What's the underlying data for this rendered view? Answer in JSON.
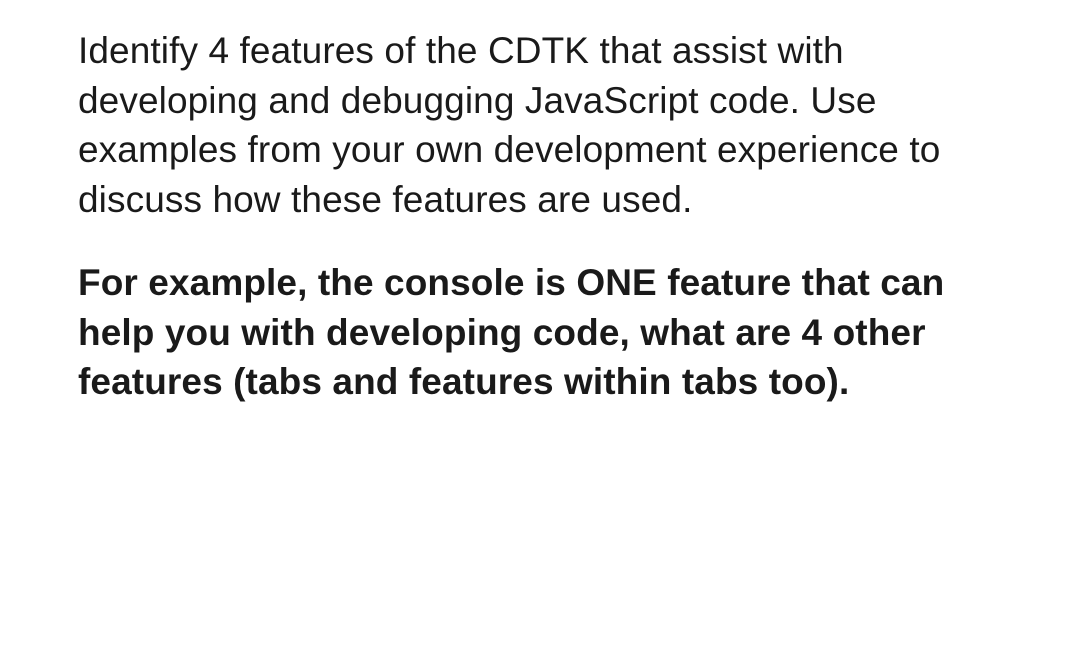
{
  "document": {
    "paragraphs": [
      {
        "text": "Identify 4 features of the CDTK that assist with developing and debugging JavaScript code. Use examples from your own development experience to discuss how these features are used.",
        "bold": false
      },
      {
        "text": "For example, the console is ONE feature that can help you with developing code, what are 4 other features (tabs and features within tabs too).",
        "bold": true
      }
    ]
  }
}
